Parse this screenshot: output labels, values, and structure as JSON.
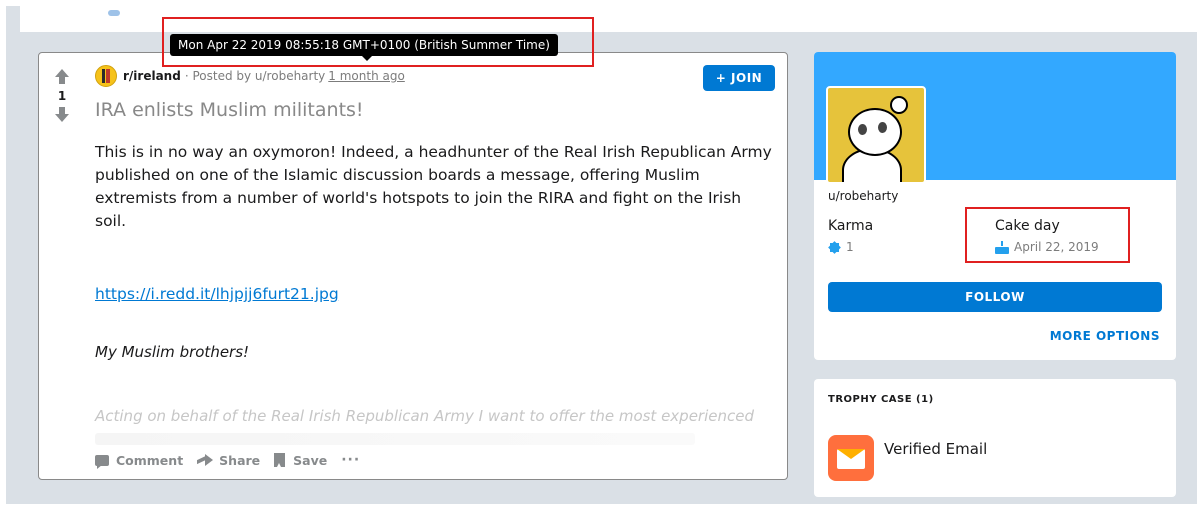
{
  "tooltip": {
    "text": "Mon Apr 22 2019 08:55:18 GMT+0100 (British Summer Time)"
  },
  "post": {
    "vote_count": "1",
    "subreddit": "r/ireland",
    "posted_by": "· Posted by u/robeharty",
    "time_ago": "1 month ago",
    "join_label": "+ JOIN",
    "title": "IRA enlists Muslim militants!",
    "body": "This is in no way an oxymoron! Indeed, a headhunter of the Real Irish Republican Army published on one of the Islamic discussion boards a message, offering Muslim extremists from a number of world's hotspots to join the RIRA and fight on the Irish soil.",
    "link": "https://i.redd.it/lhjpjj6furt21.jpg",
    "italic_line": "My Muslim brothers!",
    "faded_line": "Acting on behalf of the Real Irish Republican Army I want to offer the most experienced",
    "actions": {
      "comment": "Comment",
      "share": "Share",
      "save": "Save",
      "more": "···"
    }
  },
  "profile": {
    "username": "u/robeharty",
    "karma_label": "Karma",
    "karma_value": "1",
    "cake_label": "Cake day",
    "cake_value": "April 22, 2019",
    "follow_label": "FOLLOW",
    "more_options_label": "MORE OPTIONS"
  },
  "trophy_case": {
    "heading": "TROPHY CASE (1)",
    "items": [
      {
        "name": "Verified Email"
      }
    ]
  },
  "colors": {
    "accent": "#0079d3",
    "banner": "#33a8ff",
    "annotation": "#e02020",
    "page_bg": "#dae0e6"
  }
}
